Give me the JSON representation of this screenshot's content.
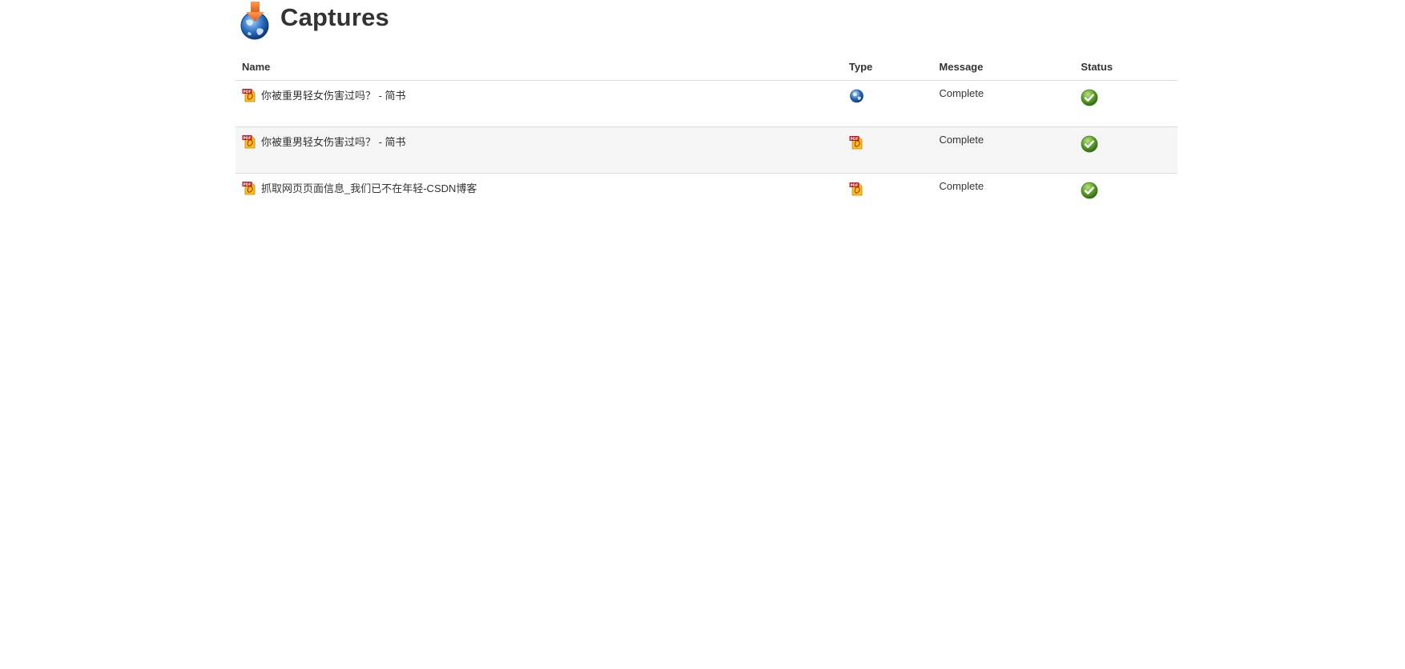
{
  "page": {
    "title": "Captures",
    "logo_icon": "capture-globe-download-icon"
  },
  "table": {
    "columns": {
      "name": "Name",
      "type": "Type",
      "message": "Message",
      "status": "Status"
    },
    "rows": [
      {
        "name": "你被重男轻女伤害过吗？ - 简书",
        "name_icon": "pdf-file-icon",
        "type_icon": "globe-icon",
        "message": "Complete",
        "status_icon": "green-check-icon"
      },
      {
        "name": "你被重男轻女伤害过吗？ - 简书",
        "name_icon": "pdf-file-icon",
        "type_icon": "pdf-file-icon",
        "message": "Complete",
        "status_icon": "green-check-icon"
      },
      {
        "name": "抓取网页页面信息_我们已不在年轻-CSDN博客",
        "name_icon": "pdf-file-icon",
        "type_icon": "pdf-file-icon",
        "message": "Complete",
        "status_icon": "green-check-icon"
      }
    ]
  },
  "colors": {
    "text": "#333333",
    "border": "#dddddd",
    "stripe": "#f5f5f5",
    "check_green": "#5a9a2a",
    "accent_orange": "#f07a2a",
    "globe_blue": "#2a6fbf"
  }
}
